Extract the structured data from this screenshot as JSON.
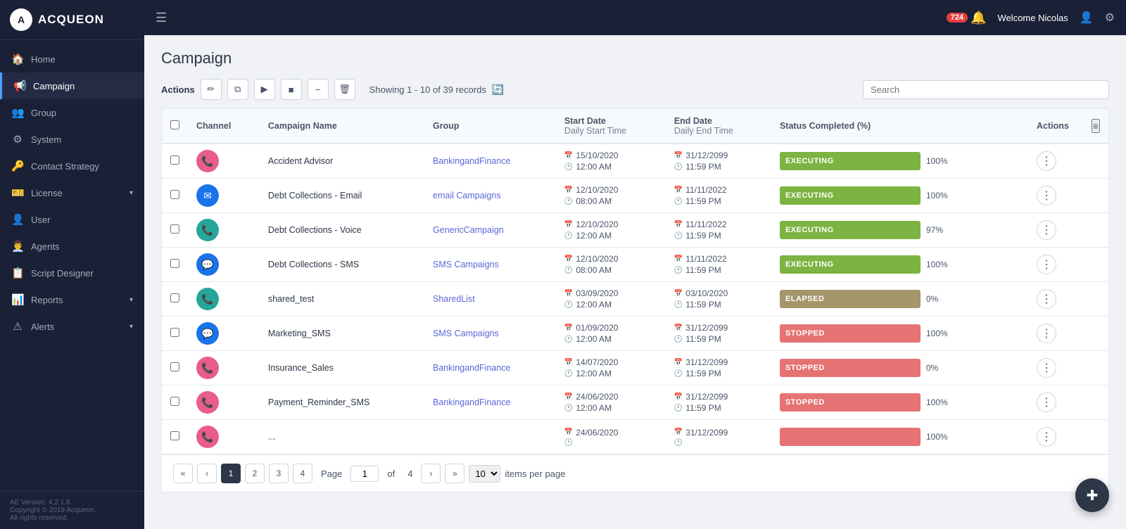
{
  "app": {
    "name": "ACQUEON",
    "version": "AE Version: 4.2.1.8",
    "copyright": "Copyright © 2019 Acqueon.",
    "rights": "All rights reserved."
  },
  "header": {
    "hamburger": "☰",
    "notification_count": "724",
    "welcome": "Welcome Nicolas",
    "bell": "🔔",
    "user_icon": "👤",
    "share_icon": "⚙"
  },
  "sidebar": {
    "items": [
      {
        "label": "Home",
        "icon": "🏠",
        "active": false
      },
      {
        "label": "Campaign",
        "icon": "📢",
        "active": true
      },
      {
        "label": "Group",
        "icon": "👥",
        "active": false
      },
      {
        "label": "System",
        "icon": "⚙",
        "active": false
      },
      {
        "label": "Contact Strategy",
        "icon": "🔑",
        "active": false
      },
      {
        "label": "License",
        "icon": "🎫",
        "active": false,
        "hasChevron": true
      },
      {
        "label": "User",
        "icon": "👤",
        "active": false
      },
      {
        "label": "Agents",
        "icon": "👨‍💼",
        "active": false
      },
      {
        "label": "Script Designer",
        "icon": "📋",
        "active": false
      },
      {
        "label": "Reports",
        "icon": "📊",
        "active": false,
        "hasChevron": true
      },
      {
        "label": "Alerts",
        "icon": "⚠",
        "active": false,
        "hasChevron": true
      }
    ]
  },
  "page": {
    "title": "Campaign",
    "actions_label": "Actions",
    "records_info": "Showing 1 - 10 of 39 records",
    "search_placeholder": "Search"
  },
  "toolbar": {
    "edit": "✏",
    "copy": "⧉",
    "play": "▶",
    "stop": "■",
    "minus": "−",
    "delete": "🗑"
  },
  "table": {
    "columns": [
      "",
      "Channel",
      "Campaign Name",
      "Group",
      "Start Date / Daily Start Time",
      "End Date / Daily End Time",
      "Status Completed (%)",
      "Actions"
    ],
    "rows": [
      {
        "channel_color": "#e85d8a",
        "channel_icon": "📞",
        "channel_type": "voice_pink",
        "campaign_name": "Accident Advisor",
        "group": "BankingandFinance",
        "start_date": "15/10/2020",
        "start_time": "12:00 AM",
        "end_date": "31/12/2099",
        "end_time": "11:59 PM",
        "status": "EXECUTING",
        "status_color": "#7cb342",
        "pct": "100%"
      },
      {
        "channel_color": "#1a73e8",
        "channel_icon": "✉",
        "channel_type": "email",
        "campaign_name": "Debt Collections - Email",
        "group": "email Campaigns",
        "start_date": "12/10/2020",
        "start_time": "08:00 AM",
        "end_date": "11/11/2022",
        "end_time": "11:59 PM",
        "status": "EXECUTING",
        "status_color": "#7cb342",
        "pct": "100%"
      },
      {
        "channel_color": "#26a69a",
        "channel_icon": "📞",
        "channel_type": "voice_teal",
        "campaign_name": "Debt Collections - Voice",
        "group": "GenericCampaign",
        "start_date": "12/10/2020",
        "start_time": "12:00 AM",
        "end_date": "11/11/2022",
        "end_time": "11:59 PM",
        "status": "EXECUTING",
        "status_color": "#7cb342",
        "pct": "97%"
      },
      {
        "channel_color": "#1a73e8",
        "channel_icon": "💬",
        "channel_type": "sms_blue",
        "campaign_name": "Debt Collections - SMS",
        "group": "SMS Campaigns",
        "start_date": "12/10/2020",
        "start_time": "08:00 AM",
        "end_date": "11/11/2022",
        "end_time": "11:59 PM",
        "status": "EXECUTING",
        "status_color": "#7cb342",
        "pct": "100%"
      },
      {
        "channel_color": "#26a69a",
        "channel_icon": "📞",
        "channel_type": "voice_teal",
        "campaign_name": "shared_test",
        "group": "SharedList",
        "start_date": "03/09/2020",
        "start_time": "12:00 AM",
        "end_date": "03/10/2020",
        "end_time": "11:59 PM",
        "status": "ELAPSED",
        "status_color": "#a5956a",
        "pct": "0%"
      },
      {
        "channel_color": "#1a73e8",
        "channel_icon": "💬",
        "channel_type": "sms_blue",
        "campaign_name": "Marketing_SMS",
        "group": "SMS Campaigns",
        "start_date": "01/09/2020",
        "start_time": "12:00 AM",
        "end_date": "31/12/2099",
        "end_time": "11:59 PM",
        "status": "STOPPED",
        "status_color": "#e57373",
        "pct": "100%"
      },
      {
        "channel_color": "#e85d8a",
        "channel_icon": "📞",
        "channel_type": "voice_pink",
        "campaign_name": "Insurance_Sales",
        "group": "BankingandFinance",
        "start_date": "14/07/2020",
        "start_time": "12:00 AM",
        "end_date": "31/12/2099",
        "end_time": "11:59 PM",
        "status": "STOPPED",
        "status_color": "#e57373",
        "pct": "0%"
      },
      {
        "channel_color": "#e85d8a",
        "channel_icon": "📞",
        "channel_type": "voice_pink",
        "campaign_name": "Payment_Reminder_SMS",
        "group": "BankingandFinance",
        "start_date": "24/06/2020",
        "start_time": "12:00 AM",
        "end_date": "31/12/2099",
        "end_time": "11:59 PM",
        "status": "STOPPED",
        "status_color": "#e57373",
        "pct": "100%"
      },
      {
        "channel_color": "#e85d8a",
        "channel_icon": "📞",
        "channel_type": "voice_pink",
        "campaign_name": "...",
        "group": "",
        "start_date": "24/06/2020",
        "start_time": "",
        "end_date": "31/12/2099",
        "end_time": "",
        "status": "",
        "status_color": "#e57373",
        "pct": "100%"
      }
    ]
  },
  "pagination": {
    "current_page": "1",
    "total_pages": "4",
    "pages": [
      "1",
      "2",
      "3",
      "4"
    ],
    "page_label": "Page",
    "of_label": "of",
    "items_per_page": "10",
    "items_label": "items per page",
    "nav": {
      "first": "«",
      "prev": "‹",
      "next": "›",
      "last": "»"
    }
  },
  "fab": {
    "icon": "✚"
  }
}
